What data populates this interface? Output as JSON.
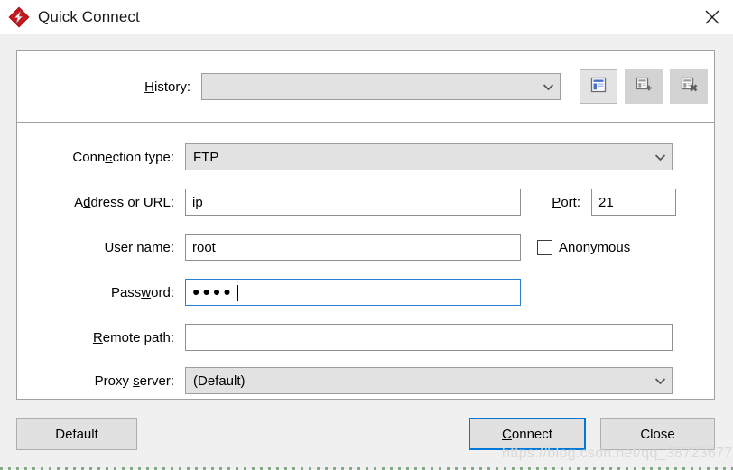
{
  "window": {
    "title": "Quick Connect",
    "app_icon": "filezilla-icon",
    "close_icon": "close-icon",
    "brand_color": "#b01116",
    "accent_color": "#0078d7"
  },
  "history": {
    "label_prefix": "",
    "label_accel": "H",
    "label_suffix": "istory:",
    "value": "",
    "dropdown_icon": "chevron-down-icon",
    "buttons": [
      {
        "name": "show-history-button",
        "icon": "history-list-icon",
        "state": "active"
      },
      {
        "name": "add-bookmark-button",
        "icon": "list-add-icon",
        "state": "normal"
      },
      {
        "name": "remove-bookmark-button",
        "icon": "list-remove-icon",
        "state": "normal"
      }
    ]
  },
  "fields": {
    "connection_type": {
      "label_prefix": "Conn",
      "label_accel": "e",
      "label_suffix": "ction type:",
      "value": "FTP",
      "dropdown_icon": "chevron-down-icon"
    },
    "address": {
      "label_prefix": "A",
      "label_accel": "d",
      "label_suffix": "dress or URL:",
      "value": "ip",
      "placeholder": ""
    },
    "port": {
      "label_prefix": "",
      "label_accel": "P",
      "label_suffix": "ort:",
      "value": "21",
      "placeholder": ""
    },
    "username": {
      "label_prefix": "",
      "label_accel": "U",
      "label_suffix": "ser name:",
      "value": "root",
      "placeholder": ""
    },
    "anonymous": {
      "label_prefix": "",
      "label_accel": "A",
      "label_suffix": "nonymous",
      "checked": false
    },
    "password": {
      "label_prefix": "Pass",
      "label_accel": "w",
      "label_suffix": "ord:",
      "value": "●●●●",
      "char_count": 4,
      "focused": true
    },
    "remote_path": {
      "label_prefix": "",
      "label_accel": "R",
      "label_suffix": "emote path:",
      "value": "",
      "placeholder": ""
    },
    "proxy_server": {
      "label_prefix": "Proxy ",
      "label_accel": "s",
      "label_suffix": "erver:",
      "value": "(Default)",
      "dropdown_icon": "chevron-down-icon"
    }
  },
  "footer": {
    "default_button": "Default",
    "connect_prefix": "",
    "connect_accel": "C",
    "connect_suffix": "onnect",
    "close_button": "Close"
  },
  "watermark": {
    "text": "https://blog.csdn.net/qq_38723677"
  }
}
